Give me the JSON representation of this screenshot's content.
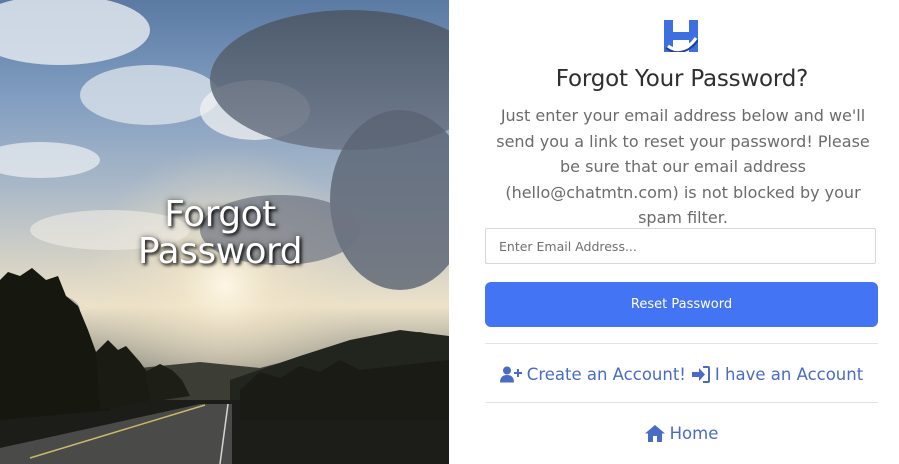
{
  "hero": {
    "title_line1": "Forgot",
    "title_line2": "Password"
  },
  "logo": {
    "icon": "h-brand-logo-icon",
    "color": "#3d6fe0"
  },
  "form": {
    "title": "Forgot Your Password?",
    "description": "Just enter your email address below and we'll send you a link to reset your password! Please be sure that our email address (hello@chatmtn.com) is not blocked by your spam filter.",
    "email_placeholder": "Enter Email Address...",
    "email_value": "",
    "submit_label": "Reset Password"
  },
  "links": {
    "create_account": {
      "label": "Create an Account!",
      "icon": "user-plus-icon"
    },
    "login": {
      "label": "I have an Account",
      "icon": "sign-in-icon"
    },
    "home": {
      "label": "Home",
      "icon": "home-icon"
    }
  },
  "colors": {
    "accent": "#4374f4",
    "link": "#4a6bc5",
    "text": "#2f2f2f",
    "muted": "#6b6b6b"
  }
}
